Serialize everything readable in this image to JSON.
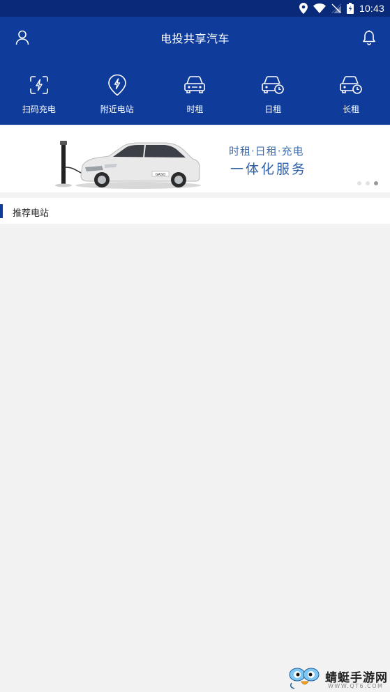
{
  "status_bar": {
    "time": "10:43"
  },
  "header": {
    "title": "电投共享汽车",
    "user_icon": "user-icon",
    "bell_icon": "bell-icon"
  },
  "nav": [
    {
      "label": "扫码充电",
      "icon": "scan-charge-icon"
    },
    {
      "label": "附近电站",
      "icon": "location-bolt-icon"
    },
    {
      "label": "时租",
      "icon": "car-icon"
    },
    {
      "label": "日租",
      "icon": "car-clock-icon"
    },
    {
      "label": "长租",
      "icon": "car-clock-icon"
    }
  ],
  "banner": {
    "line1": "时租·日租·充电",
    "line2": "一体化服务",
    "plate": "GASO",
    "slides": 3,
    "active_slide": 3
  },
  "section": {
    "title": "推荐电站"
  },
  "watermark": {
    "name": "蜻蜓手游网",
    "url": "WWW.QT6.COM"
  },
  "colors": {
    "status_bar": "#082a78",
    "header": "#0f3c9b",
    "banner_text": "#2f61a8",
    "background": "#f2f2f2"
  }
}
